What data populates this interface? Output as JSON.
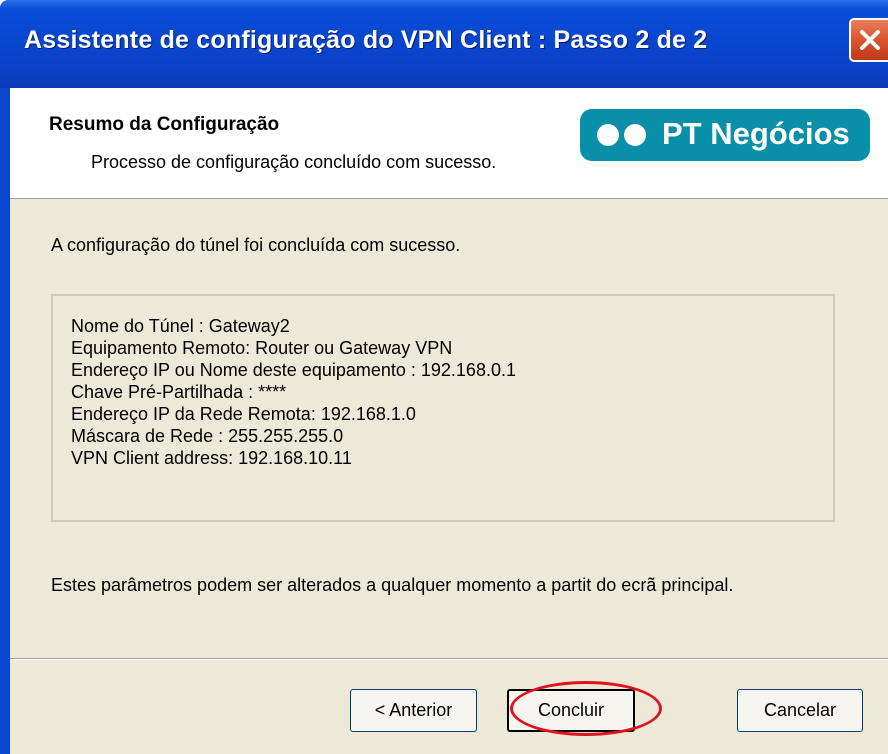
{
  "window": {
    "title": "Assistente de configuração do VPN Client : Passo 2 de 2"
  },
  "header": {
    "title": "Resumo da Configuração",
    "subtitle": "Processo de configuração concluído com sucesso.",
    "logo_text": "PT Negócios"
  },
  "content": {
    "intro": "A configuração do túnel foi concluída com sucesso.",
    "summary_lines": [
      "Nome do Túnel : Gateway2",
      "Equipamento Remoto: Router ou Gateway VPN",
      "Endereço IP ou Nome deste equipamento : 192.168.0.1",
      "Chave Pré-Partilhada : ****",
      "Endereço IP da Rede Remota: 192.168.1.0",
      "Máscara de Rede : 255.255.255.0",
      "VPN Client address: 192.168.10.11"
    ],
    "note": "Estes parâmetros podem ser alterados a qualquer momento a partit do ecrã principal."
  },
  "buttons": {
    "back_label": "< Anterior",
    "finish_label": "Concluir",
    "cancel_label": "Cancelar"
  },
  "colors": {
    "titlebar": "#0846cf",
    "logo_bg": "#0a8fa8",
    "dialog_bg": "#ece9d8",
    "highlight": "#e0141e"
  }
}
